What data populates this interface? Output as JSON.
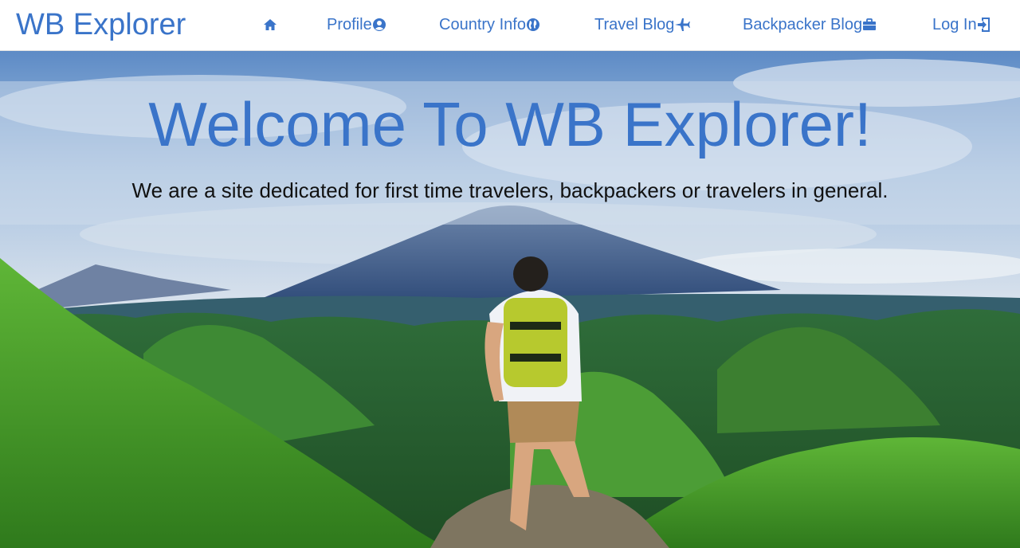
{
  "brand": "WB Explorer",
  "nav": {
    "home_icon": "home-icon",
    "items": [
      {
        "label": "Profile",
        "icon": "user-circle-icon"
      },
      {
        "label": "Country Info",
        "icon": "globe-icon"
      },
      {
        "label": "Travel Blog",
        "icon": "plane-icon"
      },
      {
        "label": "Backpacker Blog",
        "icon": "briefcase-icon"
      },
      {
        "label": "Log In",
        "icon": "log-in-icon"
      }
    ]
  },
  "hero": {
    "title": "Welcome To WB Explorer!",
    "subtitle": "We are a site dedicated for first time travelers, backpackers or travelers in general.",
    "image": "hiker-with-backpack-overlooking-green-hills-and-volcano"
  },
  "colors": {
    "accent": "#3a74c9",
    "sky": "#7fa3cf",
    "grass": "#4a9a2a"
  }
}
